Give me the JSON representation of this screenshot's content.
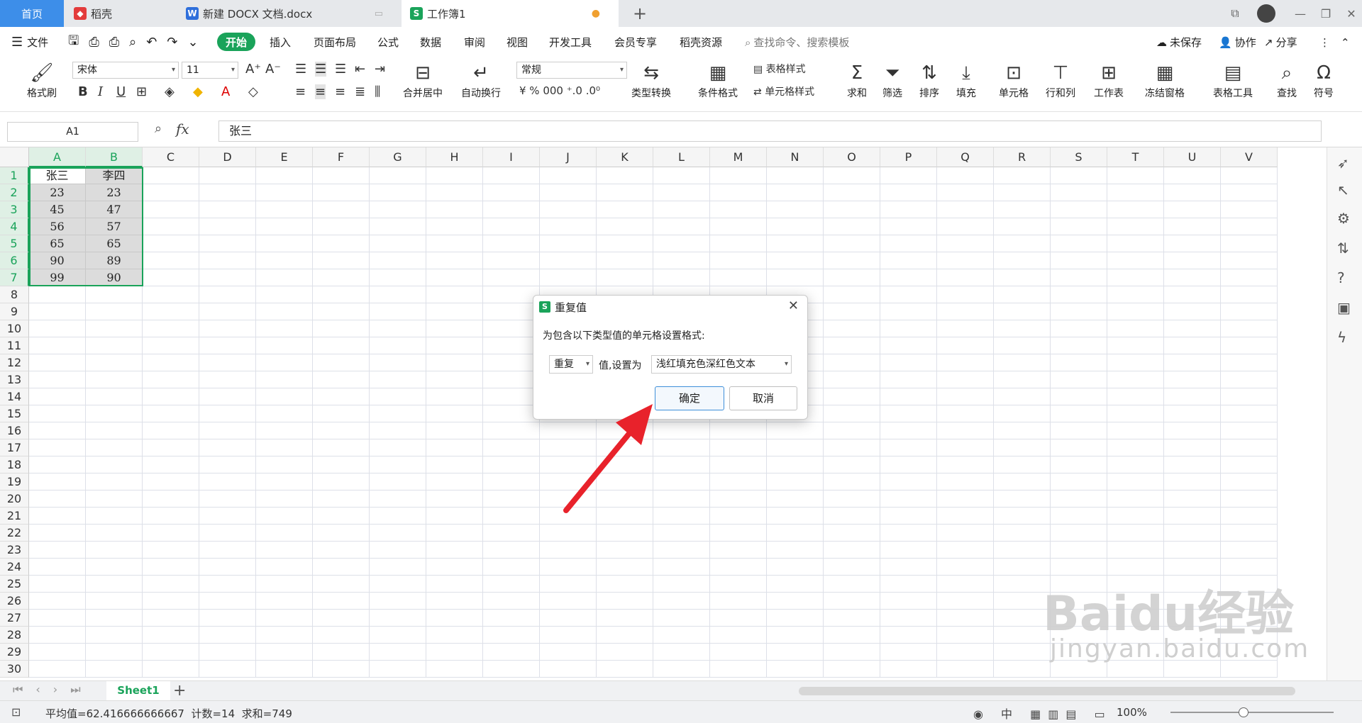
{
  "tabs": {
    "home": "首页",
    "docer": "稻壳",
    "docx": "新建 DOCX 文档.docx",
    "book": "工作簿1",
    "plus": "+"
  },
  "menu": {
    "file": "文件",
    "items": [
      "开始",
      "插入",
      "页面布局",
      "公式",
      "数据",
      "审阅",
      "视图",
      "开发工具",
      "会员专享",
      "稻壳资源"
    ],
    "search": "查找命令、搜索模板",
    "unsaved": "未保存",
    "collab": "协作",
    "share": "分享"
  },
  "ribbon": {
    "format_painter": "格式刷",
    "font_name": "宋体",
    "font_size": "11",
    "merge_center": "合并居中",
    "wrap_text": "自动换行",
    "number_format": "常规",
    "type_convert": "类型转换",
    "cond_format": "条件格式",
    "table_style": "表格样式",
    "cell_style": "单元格样式",
    "sum": "求和",
    "filter": "筛选",
    "sort": "排序",
    "fill": "填充",
    "cell": "单元格",
    "rowcol": "行和列",
    "worksheet": "工作表",
    "freeze": "冻结窗格",
    "table_tools": "表格工具",
    "find": "查找",
    "symbol": "符号"
  },
  "formula_bar": {
    "name_box": "A1",
    "fx": "fx",
    "content": "张三"
  },
  "columns": [
    "A",
    "B",
    "C",
    "D",
    "E",
    "F",
    "G",
    "H",
    "I",
    "J",
    "K",
    "L",
    "M",
    "N",
    "O",
    "P",
    "Q",
    "R",
    "S",
    "T",
    "U",
    "V"
  ],
  "rows": [
    "1",
    "2",
    "3",
    "4",
    "5",
    "6",
    "7",
    "8",
    "9",
    "10",
    "11",
    "12",
    "13",
    "14",
    "15",
    "16",
    "17",
    "18",
    "19",
    "20",
    "21",
    "22",
    "23",
    "24",
    "25",
    "26",
    "27",
    "28",
    "29",
    "30"
  ],
  "cells": {
    "A": [
      "张三",
      "23",
      "45",
      "56",
      "65",
      "90",
      "99"
    ],
    "B": [
      "李四",
      "23",
      "47",
      "57",
      "65",
      "89",
      "90"
    ]
  },
  "sheet": {
    "name": "Sheet1",
    "add": "+"
  },
  "status": {
    "summary": "平均值=62.416666666667  计数=14  求和=749",
    "zoom": "100%"
  },
  "dialog": {
    "title": "重复值",
    "prompt": "为包含以下类型值的单元格设置格式:",
    "type_value": "重复",
    "middle_label": "值,设置为",
    "format_value": "浅红填充色深红色文本",
    "ok": "确定",
    "cancel": "取消"
  },
  "watermark": {
    "brand": "Baidu经验",
    "url": "jingyan.baidu.com"
  },
  "colors": {
    "accent_green": "#1aa35a",
    "tab_blue": "#3d8ee9",
    "arrow_red": "#e8222b"
  }
}
